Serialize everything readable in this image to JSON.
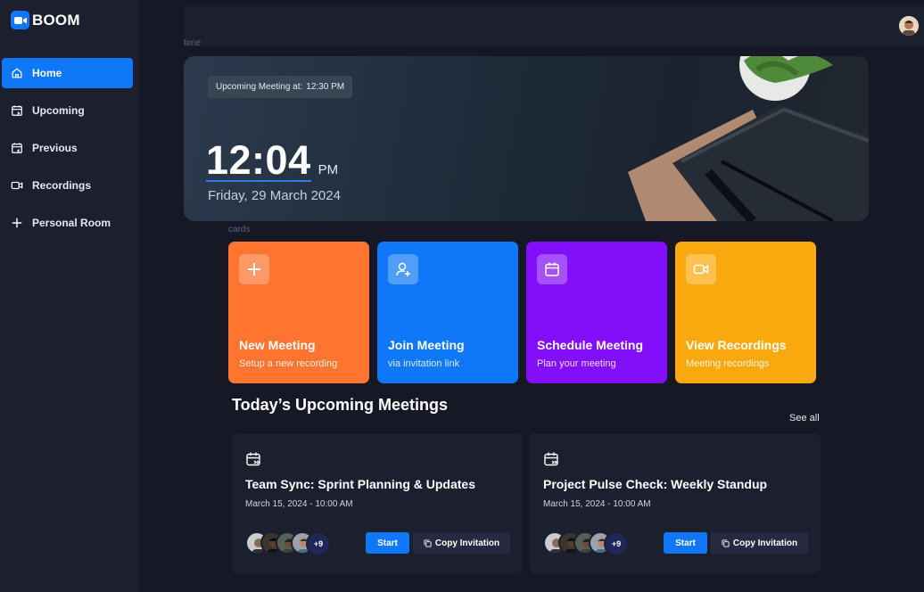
{
  "app": {
    "name": "BOOM"
  },
  "sidebar": {
    "items": [
      {
        "label": "Home",
        "icon": "home-icon",
        "active": true
      },
      {
        "label": "Upcoming",
        "icon": "calendar-upcoming-icon",
        "active": false
      },
      {
        "label": "Previous",
        "icon": "calendar-previous-icon",
        "active": false
      },
      {
        "label": "Recordings",
        "icon": "video-icon",
        "active": false
      },
      {
        "label": "Personal Room",
        "icon": "plus-icon",
        "active": false
      }
    ]
  },
  "labels": {
    "time": "time",
    "cards": "cards"
  },
  "hero": {
    "upcoming_label": "Upcoming Meeting at:",
    "upcoming_time": "12:30 PM",
    "time": "12:04",
    "ampm": "PM",
    "date": "Friday, 29 March 2024"
  },
  "cards": [
    {
      "title": "New Meeting",
      "subtitle": "Setup a new recording",
      "color": "#ff742e",
      "icon": "plus-icon"
    },
    {
      "title": "Join Meeting",
      "subtitle": "via invitation link",
      "color": "#0e78f9",
      "icon": "add-user-icon"
    },
    {
      "title": "Schedule Meeting",
      "subtitle": "Plan your meeting",
      "color": "#830ef9",
      "icon": "calendar-icon"
    },
    {
      "title": "View Recordings",
      "subtitle": "Meeting recordings",
      "color": "#f9a90e",
      "icon": "video-icon"
    }
  ],
  "upcoming": {
    "heading": "Today’s Upcoming Meetings",
    "see_all": "See all",
    "meetings": [
      {
        "title": "Team Sync: Sprint Planning & Updates",
        "date": "March 15, 2024 - 10:00 AM",
        "more": "+9",
        "start": "Start",
        "copy": "Copy Invitation"
      },
      {
        "title": "Project Pulse Check: Weekly Standup",
        "date": "March 15, 2024 - 10:00 AM",
        "more": "+9",
        "start": "Start",
        "copy": "Copy Invitation"
      }
    ]
  }
}
